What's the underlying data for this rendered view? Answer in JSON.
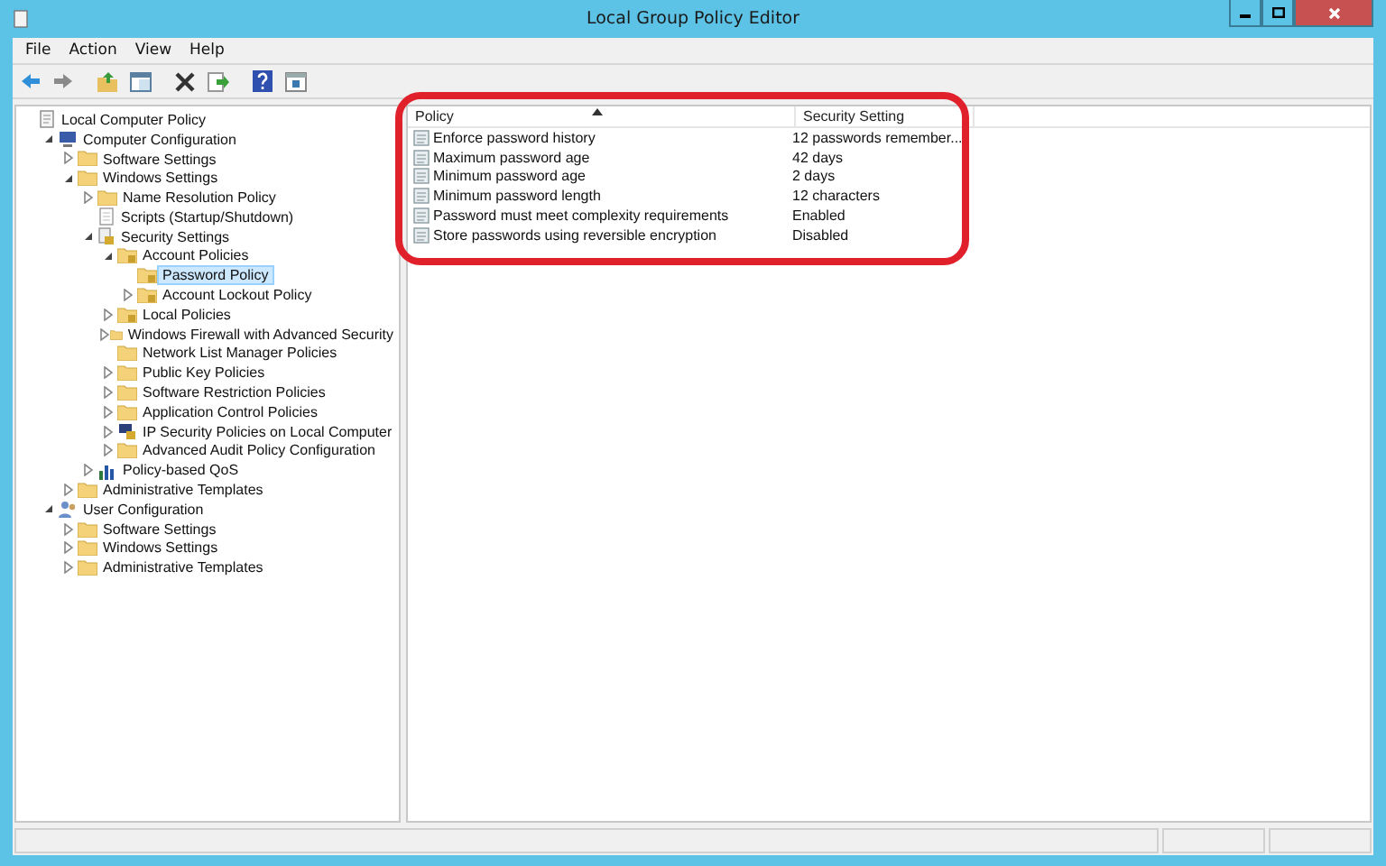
{
  "window": {
    "title": "Local Group Policy Editor"
  },
  "menu": [
    "File",
    "Action",
    "View",
    "Help"
  ],
  "tree": [
    {
      "label": "Local Computer Policy",
      "kind": "policy",
      "selected": false,
      "children": [
        {
          "label": "Computer Configuration",
          "kind": "computer",
          "expanded": true,
          "selected": false,
          "children": [
            {
              "label": "Software Settings",
              "kind": "folder",
              "expanded": false,
              "selected": false
            },
            {
              "label": "Windows Settings",
              "kind": "folder",
              "expanded": true,
              "selected": false,
              "children": [
                {
                  "label": "Name Resolution Policy",
                  "kind": "folder",
                  "expanded": false,
                  "selected": false
                },
                {
                  "label": "Scripts (Startup/Shutdown)",
                  "kind": "scripts",
                  "selected": false
                },
                {
                  "label": "Security Settings",
                  "kind": "security",
                  "expanded": true,
                  "selected": false,
                  "children": [
                    {
                      "label": "Account Policies",
                      "kind": "lock-folder",
                      "expanded": true,
                      "selected": false,
                      "children": [
                        {
                          "label": "Password Policy",
                          "kind": "lock-folder",
                          "selected": true
                        },
                        {
                          "label": "Account Lockout Policy",
                          "kind": "lock-folder",
                          "expanded": false,
                          "selected": false
                        }
                      ]
                    },
                    {
                      "label": "Local Policies",
                      "kind": "lock-folder",
                      "expanded": false,
                      "selected": false
                    },
                    {
                      "label": "Windows Firewall with Advanced Security",
                      "kind": "folder",
                      "expanded": false,
                      "selected": false
                    },
                    {
                      "label": "Network List Manager Policies",
                      "kind": "folder",
                      "selected": false
                    },
                    {
                      "label": "Public Key Policies",
                      "kind": "folder",
                      "expanded": false,
                      "selected": false
                    },
                    {
                      "label": "Software Restriction Policies",
                      "kind": "folder",
                      "expanded": false,
                      "selected": false
                    },
                    {
                      "label": "Application Control Policies",
                      "kind": "folder",
                      "expanded": false,
                      "selected": false
                    },
                    {
                      "label": "IP Security Policies on Local Computer",
                      "kind": "ip-security",
                      "expanded": false,
                      "selected": false
                    },
                    {
                      "label": "Advanced Audit Policy Configuration",
                      "kind": "folder",
                      "expanded": false,
                      "selected": false
                    }
                  ]
                },
                {
                  "label": "Policy-based QoS",
                  "kind": "qos",
                  "expanded": false,
                  "selected": false
                }
              ]
            },
            {
              "label": "Administrative Templates",
              "kind": "folder",
              "expanded": false,
              "selected": false
            }
          ]
        },
        {
          "label": "User Configuration",
          "kind": "user",
          "expanded": true,
          "selected": false,
          "children": [
            {
              "label": "Software Settings",
              "kind": "folder",
              "expanded": false,
              "selected": false
            },
            {
              "label": "Windows Settings",
              "kind": "folder",
              "expanded": false,
              "selected": false
            },
            {
              "label": "Administrative Templates",
              "kind": "folder",
              "expanded": false,
              "selected": false
            }
          ]
        }
      ]
    }
  ],
  "table": {
    "columns": [
      "Policy",
      "Security Setting"
    ],
    "rows": [
      {
        "policy": "Enforce password history",
        "setting": "12 passwords remember..."
      },
      {
        "policy": "Maximum password age",
        "setting": "42 days"
      },
      {
        "policy": "Minimum password age",
        "setting": "2 days"
      },
      {
        "policy": "Minimum password length",
        "setting": "12 characters"
      },
      {
        "policy": "Password must meet complexity requirements",
        "setting": "Enabled"
      },
      {
        "policy": "Store passwords using reversible encryption",
        "setting": "Disabled"
      }
    ]
  }
}
